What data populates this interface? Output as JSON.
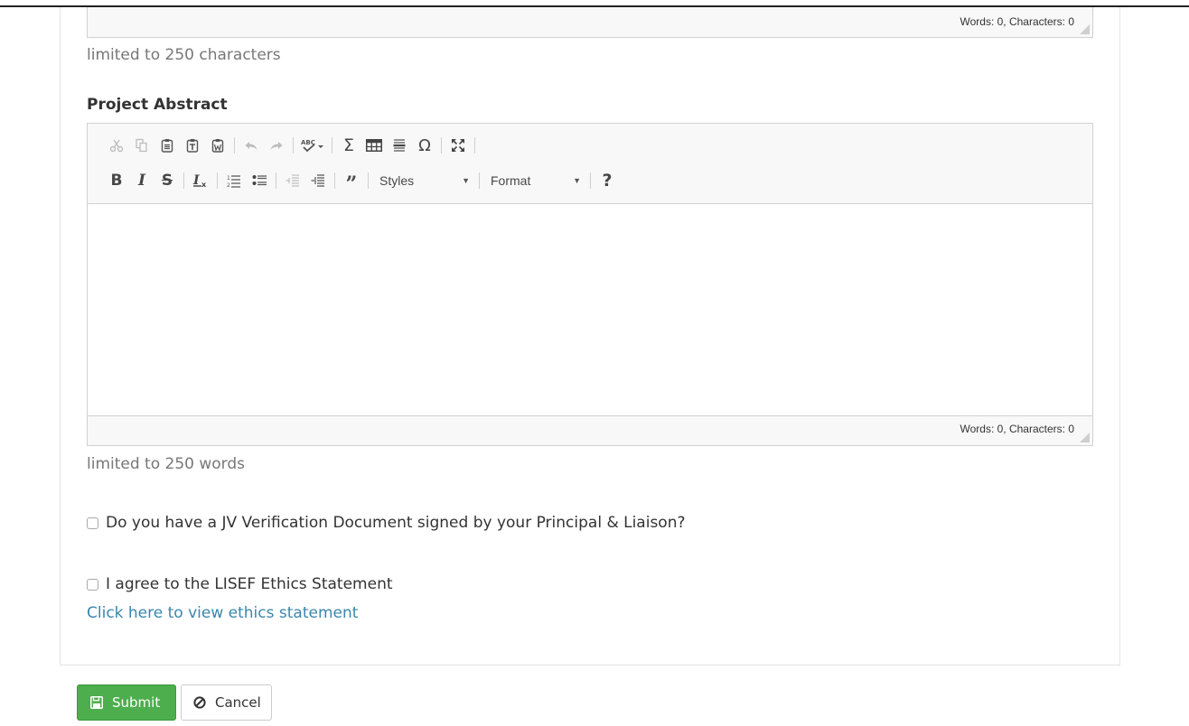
{
  "top_editor": {
    "word_count": "Words: 0, Characters: 0"
  },
  "summary_help": "limited to 250 characters",
  "abstract": {
    "label": "Project Abstract",
    "toolbar": {
      "styles_label": "Styles",
      "format_label": "Format",
      "bold": "B",
      "italic": "I",
      "strike": "S",
      "help": "?"
    },
    "word_count": "Words: 0, Characters: 0",
    "help": "limited to 250 words"
  },
  "checkbox_jv": {
    "label": "Do you have a JV Verification Document signed by your Principal & Liaison?",
    "checked": false
  },
  "checkbox_ethics": {
    "label": "I agree to the LISEF Ethics Statement",
    "checked": false
  },
  "ethics_link": "Click here to view ethics statement",
  "buttons": {
    "submit": "Submit",
    "cancel": "Cancel"
  },
  "colors": {
    "submit_bg": "#4cae4c",
    "link": "#3a87ad"
  }
}
